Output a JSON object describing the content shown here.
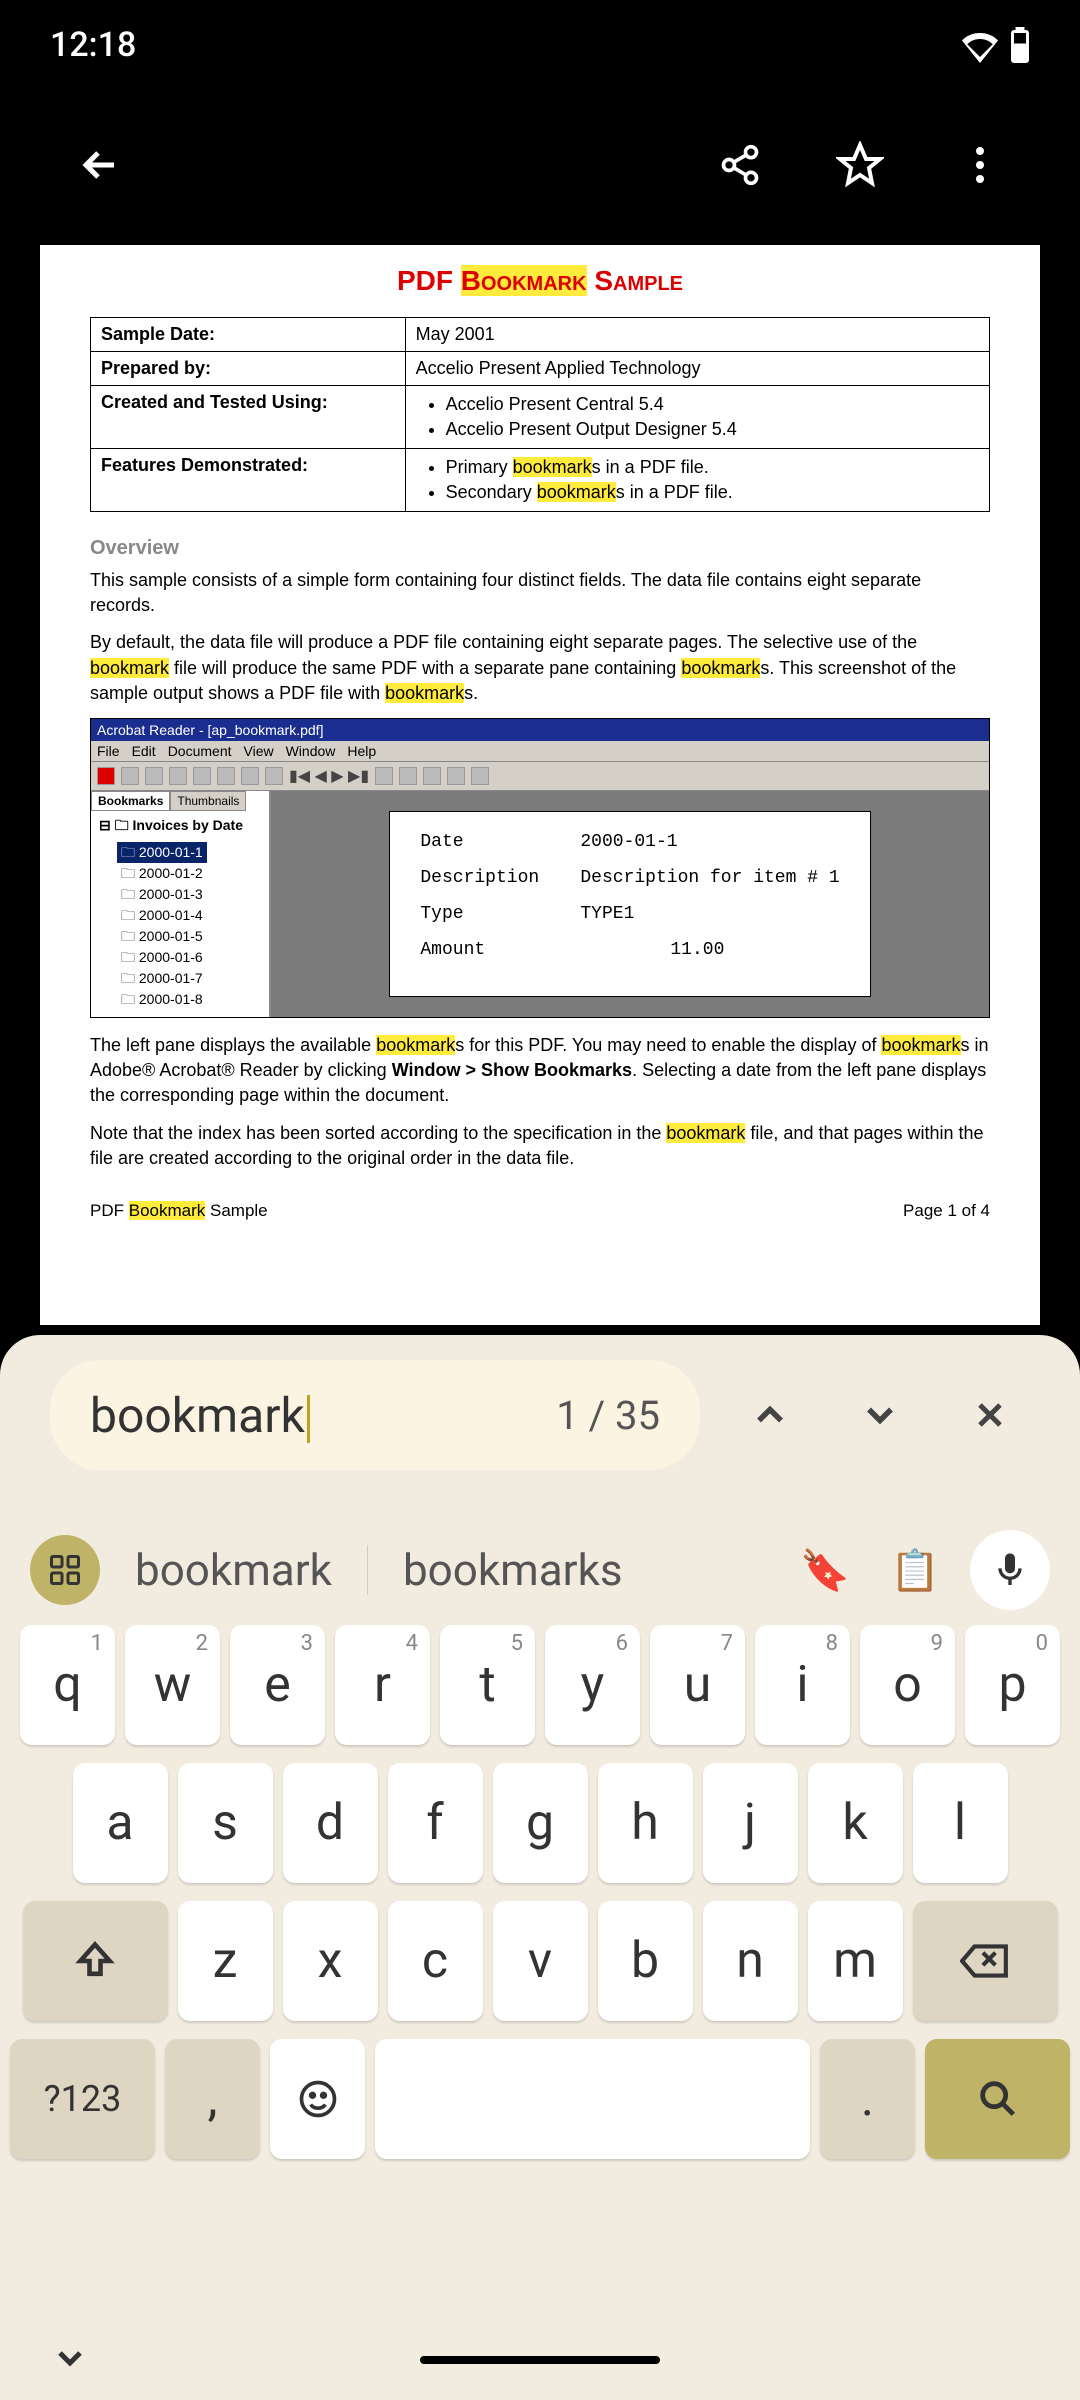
{
  "status": {
    "time": "12:18"
  },
  "pdf": {
    "title_pre": "PDF ",
    "title_hl": "Bookmark",
    "title_post": " Sample",
    "meta": {
      "sample_date_label": "Sample Date:",
      "sample_date": "May 2001",
      "prepared_label": "Prepared by:",
      "prepared": "Accelio Present Applied Technology",
      "created_label": "Created and Tested Using:",
      "created": [
        "Accelio Present Central 5.4",
        "Accelio Present Output Designer 5.4"
      ],
      "features_label": "Features Demonstrated:",
      "features_1_pre": "Primary ",
      "features_1_hl": "bookmark",
      "features_1_post": "s in a PDF file.",
      "features_2_pre": "Secondary ",
      "features_2_hl": "bookmark",
      "features_2_post": "s in a PDF file."
    },
    "overview_head": "Overview",
    "overview_p1": "This sample consists of a simple form containing four distinct fields. The data file contains eight separate records.",
    "p2_a": "By default, the data file will produce a PDF file containing eight separate pages. The selective use of the ",
    "p2_hl1": "bookmark",
    "p2_b": " file will produce the same PDF with a separate pane containing ",
    "p2_hl2": "bookmark",
    "p2_c": "s. This screenshot of the sample output shows a PDF file with ",
    "p2_hl3": "bookmark",
    "p2_d": "s.",
    "acrobat": {
      "window_title": "Acrobat Reader - [ap_bookmark.pdf]",
      "menu": [
        "File",
        "Edit",
        "Document",
        "View",
        "Window",
        "Help"
      ],
      "bm_tab": "Bookmarks",
      "thumb_tab": "Thumbnails",
      "tree_root": "Invoices by Date",
      "tree_items": [
        "2000-01-1",
        "2000-01-2",
        "2000-01-3",
        "2000-01-4",
        "2000-01-5",
        "2000-01-6",
        "2000-01-7",
        "2000-01-8"
      ],
      "form": {
        "date_label": "Date",
        "date": "2000-01-1",
        "desc_label": "Description",
        "desc": "Description for item # 1",
        "type_label": "Type",
        "type": "TYPE1",
        "amount_label": "Amount",
        "amount": "11.00"
      }
    },
    "p3_a": "The left pane displays the available ",
    "p3_hl1": "bookmark",
    "p3_b": "s for this PDF. You may need to enable the display of ",
    "p3_hl2": "bookmark",
    "p3_c": "s in Adobe® Acrobat® Reader by clicking ",
    "p3_bold": "Window > Show Bookmarks",
    "p3_d": ". Selecting a date from the left pane displays the corresponding page within the document.",
    "p4_a": "Note that the index has been sorted according to the specification in the ",
    "p4_hl": "bookmark",
    "p4_b": " file, and that pages within the file are created according to the original order in the data file.",
    "footer_left_a": "PDF ",
    "footer_left_hl": "Bookmark",
    "footer_left_b": " Sample",
    "footer_right": "Page 1 of 4"
  },
  "search": {
    "query": "bookmark",
    "count": "1 / 35"
  },
  "keyboard": {
    "sugg1": "bookmark",
    "sugg2": "bookmarks",
    "row1": [
      {
        "k": "q",
        "h": "1"
      },
      {
        "k": "w",
        "h": "2"
      },
      {
        "k": "e",
        "h": "3"
      },
      {
        "k": "r",
        "h": "4"
      },
      {
        "k": "t",
        "h": "5"
      },
      {
        "k": "y",
        "h": "6"
      },
      {
        "k": "u",
        "h": "7"
      },
      {
        "k": "i",
        "h": "8"
      },
      {
        "k": "o",
        "h": "9"
      },
      {
        "k": "p",
        "h": "0"
      }
    ],
    "row2": [
      "a",
      "s",
      "d",
      "f",
      "g",
      "h",
      "j",
      "k",
      "l"
    ],
    "row3": [
      "z",
      "x",
      "c",
      "v",
      "b",
      "n",
      "m"
    ],
    "symbols_key": "?123",
    "comma": ",",
    "period": "."
  }
}
